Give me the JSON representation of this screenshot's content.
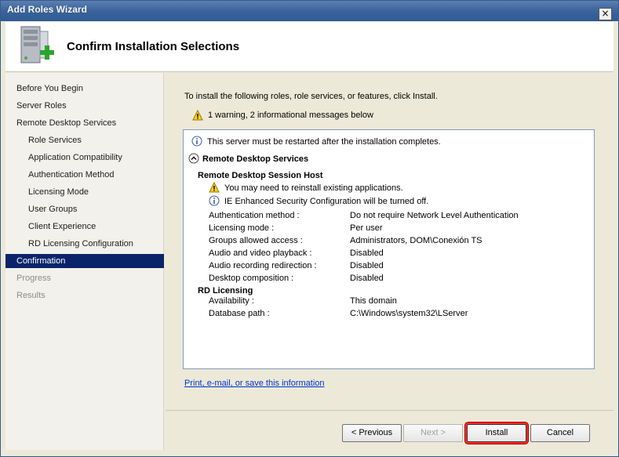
{
  "window": {
    "title": "Add Roles Wizard",
    "close_glyph": "×"
  },
  "header": {
    "heading": "Confirm Installation Selections",
    "icon": "server-add-icon"
  },
  "nav": {
    "items": [
      {
        "label": "Before You Begin",
        "state": "normal",
        "level": 1
      },
      {
        "label": "Server Roles",
        "state": "normal",
        "level": 1
      },
      {
        "label": "Remote Desktop Services",
        "state": "normal",
        "level": 1
      },
      {
        "label": "Role Services",
        "state": "normal",
        "level": 2
      },
      {
        "label": "Application Compatibility",
        "state": "normal",
        "level": 2
      },
      {
        "label": "Authentication Method",
        "state": "normal",
        "level": 2
      },
      {
        "label": "Licensing Mode",
        "state": "normal",
        "level": 2
      },
      {
        "label": "User Groups",
        "state": "normal",
        "level": 2
      },
      {
        "label": "Client Experience",
        "state": "normal",
        "level": 2
      },
      {
        "label": "RD Licensing Configuration",
        "state": "normal",
        "level": 2
      },
      {
        "label": "Confirmation",
        "state": "active",
        "level": 1
      },
      {
        "label": "Progress",
        "state": "disabled",
        "level": 1
      },
      {
        "label": "Results",
        "state": "disabled",
        "level": 1
      }
    ]
  },
  "main": {
    "intro": "To install the following roles, role services, or features, click Install.",
    "warning_summary": "1 warning, 2 informational messages below",
    "restart_info": "This server must be restarted after the installation completes.",
    "section_title": "Remote Desktop Services",
    "rdsh": {
      "title": "Remote Desktop Session Host",
      "warning": "You may need to reinstall existing applications.",
      "info": "IE Enhanced Security Configuration will be turned off.",
      "settings": [
        {
          "label": "Authentication method :",
          "value": "Do not require Network Level Authentication"
        },
        {
          "label": "Licensing mode :",
          "value": "Per user"
        },
        {
          "label": "Groups allowed access :",
          "value": "Administrators, DOM\\Conexión TS"
        },
        {
          "label": "Audio and video playback :",
          "value": "Disabled"
        },
        {
          "label": "Audio recording redirection :",
          "value": "Disabled"
        },
        {
          "label": "Desktop composition :",
          "value": "Disabled"
        }
      ]
    },
    "rdl": {
      "title": "RD Licensing",
      "settings": [
        {
          "label": "Availability :",
          "value": "This domain"
        },
        {
          "label": "Database path :",
          "value": "C:\\Windows\\system32\\LServer"
        }
      ]
    },
    "print_link": "Print, e-mail, or save this information"
  },
  "buttons": {
    "previous": "< Previous",
    "next": "Next >",
    "install": "Install",
    "cancel": "Cancel"
  },
  "colors": {
    "active_nav": "#0a246a",
    "highlight": "#ff2a2a",
    "link": "#0033cc"
  }
}
